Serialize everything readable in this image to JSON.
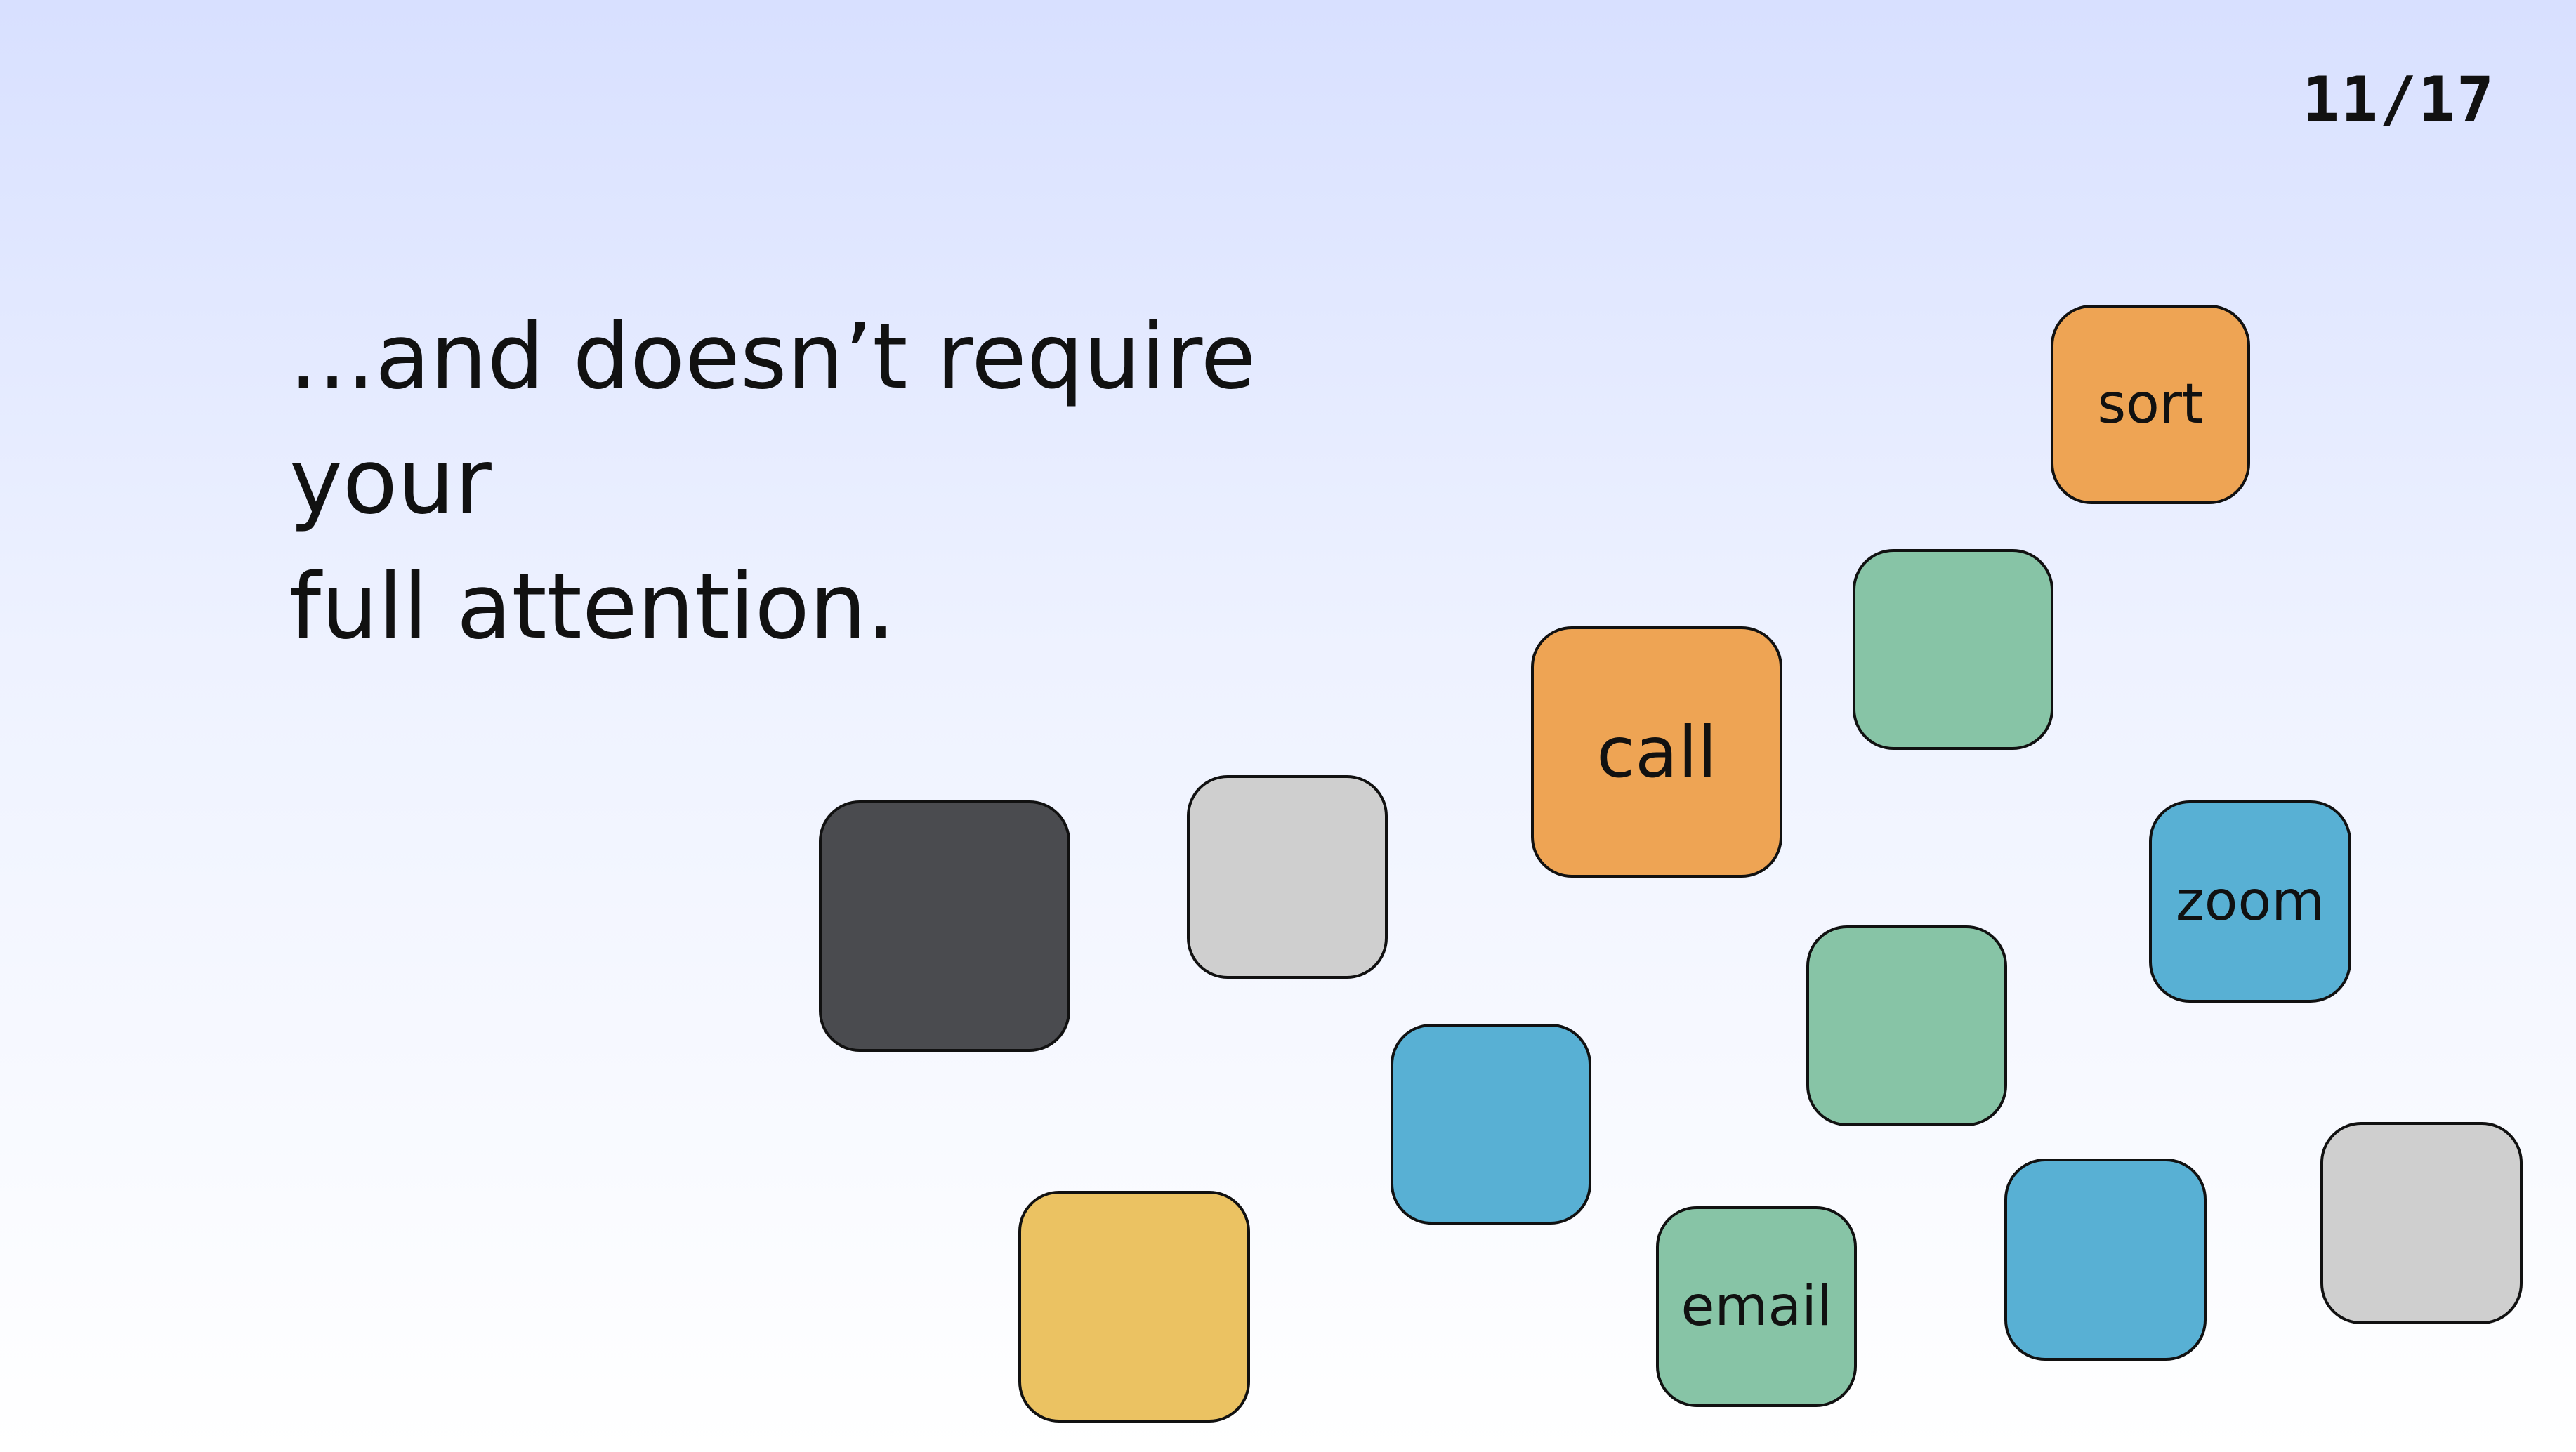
{
  "page_counter": "11/17",
  "headline": {
    "line1": "...and doesn’t require your",
    "line2": "full attention."
  },
  "tiles": {
    "sort": {
      "label": "sort",
      "color": "#eea454"
    },
    "call": {
      "label": "call",
      "color": "#eea454"
    },
    "zoom": {
      "label": "zoom",
      "color": "#58b0d4"
    },
    "email": {
      "label": "email",
      "color": "#87c4a6"
    }
  },
  "colors": {
    "dark": "#4a4b4f",
    "gray": "#cfcfcf",
    "blue": "#58b0d4",
    "green": "#87c4a6",
    "orange": "#eea454",
    "yellow": "#ebc262",
    "background_top": "#d8e0ff",
    "background_bottom": "#ffffff"
  }
}
